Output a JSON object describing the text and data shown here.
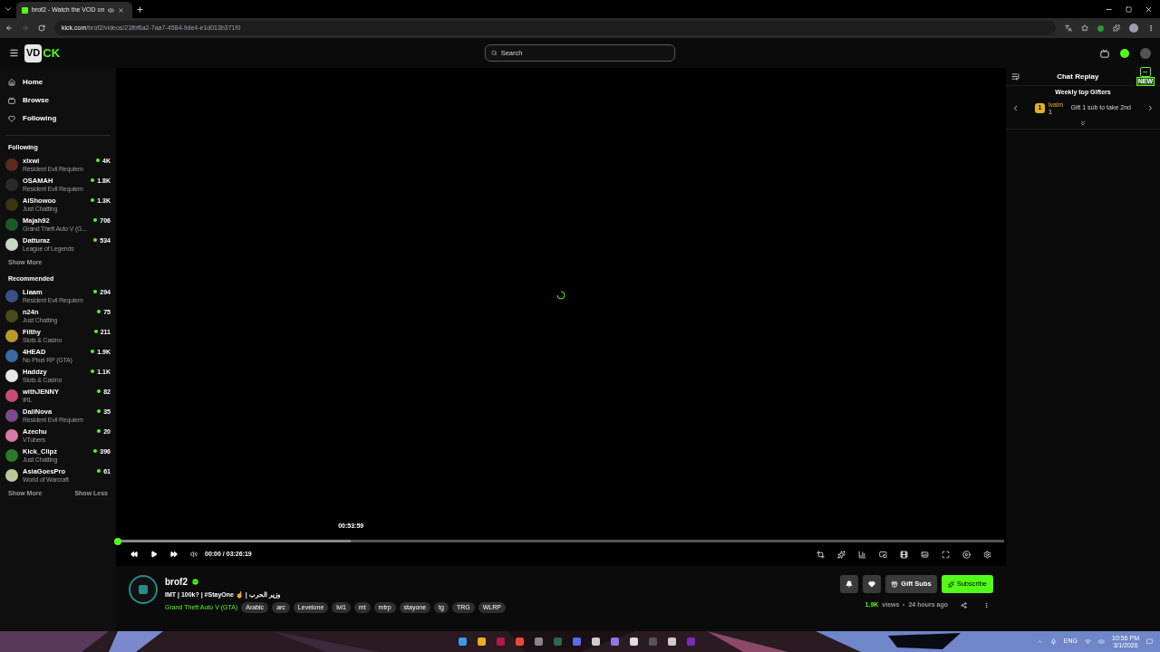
{
  "browser": {
    "tab": {
      "title": "brof2 - Watch the VOD on",
      "selected": true
    },
    "url": {
      "host": "kick.com",
      "path": "/brof2/videos/21fbf6a2-7aa7-4584-9de4-e1d013b371f0"
    }
  },
  "header": {
    "logo": {
      "badge": "VD",
      "text": "CK"
    },
    "search": {
      "placeholder": "Search"
    }
  },
  "sidebar": {
    "nav": [
      {
        "label": "Home",
        "kind": "home"
      },
      {
        "label": "Browse",
        "kind": "browse"
      },
      {
        "label": "Following",
        "kind": "heart"
      }
    ],
    "sections": [
      {
        "title": "Following",
        "channels": [
          {
            "name": "xlxwi",
            "category": "Resident Evil Requiem",
            "viewers": "4K",
            "color": "#5a2a1e"
          },
          {
            "name": "OSAMAH",
            "category": "Resident Evil Requiem",
            "viewers": "1.8K",
            "color": "#2a2a2a"
          },
          {
            "name": "AlShowoo",
            "category": "Just Chatting",
            "viewers": "1.3K",
            "color": "#3a3410"
          },
          {
            "name": "Majah92",
            "category": "Grand Theft Auto V (G...",
            "viewers": "706",
            "color": "#1d5a2a"
          },
          {
            "name": "Datturaz",
            "category": "League of Legends",
            "viewers": "534",
            "color": "#c9d6c4"
          }
        ],
        "links": [
          "Show More"
        ]
      },
      {
        "title": "Recommended",
        "channels": [
          {
            "name": "Liaam",
            "category": "Resident Evil Requiem",
            "viewers": "294",
            "color": "#3a4f8a"
          },
          {
            "name": "n24n",
            "category": "Just Chatting",
            "viewers": "75",
            "color": "#4a4a1a"
          },
          {
            "name": "Filthy",
            "category": "Slots & Casino",
            "viewers": "211",
            "color": "#b89a2a"
          },
          {
            "name": "4HEAD",
            "category": "No Pixel RP (GTA)",
            "viewers": "1.9K",
            "color": "#3a6aa0"
          },
          {
            "name": "Haddzy",
            "category": "Slots & Casino",
            "viewers": "1.1K",
            "color": "#e8e8e8"
          },
          {
            "name": "withJENNY",
            "category": "IRL",
            "viewers": "82",
            "color": "#c84a78"
          },
          {
            "name": "DaliNova",
            "category": "Resident Evil Requiem",
            "viewers": "35",
            "color": "#7a4a8a"
          },
          {
            "name": "Azechu",
            "category": "VTubers",
            "viewers": "20",
            "color": "#d87aa8"
          },
          {
            "name": "Kick_Clipz",
            "category": "Just Chatting",
            "viewers": "396",
            "color": "#2a7a2a"
          },
          {
            "name": "AsiaGoesPro",
            "category": "World of Warcraft",
            "viewers": "61",
            "color": "#b8c89a"
          }
        ],
        "links": [
          "Show More",
          "Show Less"
        ]
      }
    ]
  },
  "player": {
    "hover": {
      "time": "00:53:59",
      "level": 0.263
    },
    "progress": {
      "level": 0
    },
    "time": "00:00 / 03:26:19"
  },
  "channel": {
    "name": "brof2",
    "verified": true,
    "title": "IMT | 100k? | #StayOne ☝️ | وزير الحرب",
    "category": "Grand Theft Auto V (GTA)",
    "tags": [
      "Arabic",
      "arc",
      "Levelone",
      "lvl1",
      "mt",
      "mtrp",
      "stayone",
      "tg",
      "TRG",
      "WLRP"
    ],
    "buttons": {
      "gift": "Gift Subs",
      "subscribe": "Subscribe"
    },
    "views": "1.9K",
    "views_label": "views",
    "age": "24 hours ago"
  },
  "chat": {
    "title": "Chat Replay",
    "badge": "NEW",
    "gifters_title": "Weekly top Gifters",
    "gifter": {
      "rank": "1",
      "name": "lvalm",
      "count": "1"
    },
    "hint": "Gift 1 sub to take 2nd"
  },
  "taskbar": {
    "language": "ENG",
    "time": "10:56 PM",
    "date": "3/1/2026"
  }
}
